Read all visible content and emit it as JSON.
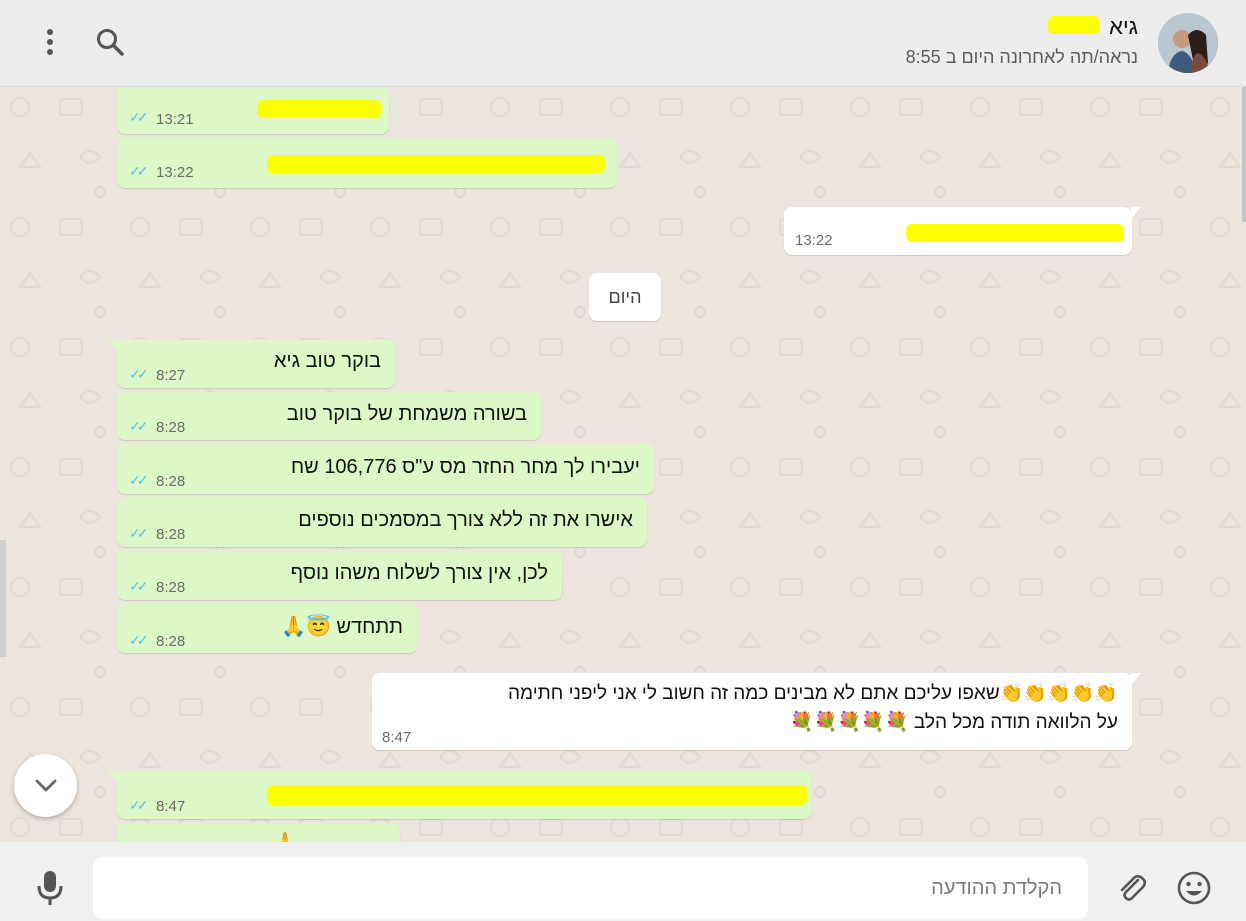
{
  "header": {
    "contact_name": "גיא",
    "status": "נראה/תה לאחרונה היום ב 8:55",
    "menu_icon": "kebab-menu-icon",
    "search_icon": "search-icon",
    "avatar": "contact-avatar"
  },
  "date_divider": "היום",
  "messages": [
    {
      "direction": "in",
      "text": "",
      "time": "13:21",
      "redacted": true
    },
    {
      "direction": "in",
      "text": "",
      "time": "13:22",
      "redacted": true
    },
    {
      "direction": "out",
      "text": "",
      "time": "13:22",
      "redacted": true
    },
    {
      "direction": "in",
      "text": "בוקר טוב גיא",
      "time": "8:27"
    },
    {
      "direction": "in",
      "text": "בשורה משמחת של בוקר טוב",
      "time": "8:28"
    },
    {
      "direction": "in",
      "text": "יעבירו לך מחר החזר מס ע\"ס 106,776 שח",
      "time": "8:28"
    },
    {
      "direction": "in",
      "text": "אישרו את זה ללא צורך במסמכים נוספים",
      "time": "8:28"
    },
    {
      "direction": "in",
      "text": "לכן, אין צורך לשלוח משהו נוסף",
      "time": "8:28"
    },
    {
      "direction": "in",
      "text": "תתחדש 😇🙏",
      "time": "8:28"
    },
    {
      "direction": "out",
      "text_line1": "👏👏👏👏👏שאפו עליכם אתם לא מבינים כמה זה חשוב לי אני ליפני חתימה",
      "text_line2": "על הלוואה תודה מכל הלב 💐💐💐💐💐",
      "time": "8:47"
    },
    {
      "direction": "in",
      "text": "",
      "time": "8:47",
      "redacted": true
    }
  ],
  "colors": {
    "incoming_bubble": "#dcf8c6",
    "outgoing_bubble": "#ffffff",
    "read_ticks": "#4fc3f7",
    "chat_background": "#ece5dd",
    "redaction": "#ffff00"
  },
  "composer": {
    "placeholder": "הקלדת ההודעה",
    "mic_icon": "microphone-icon",
    "attach_icon": "paperclip-icon",
    "emoji_icon": "emoji-icon"
  },
  "scroll_down_icon": "chevron-down-icon"
}
